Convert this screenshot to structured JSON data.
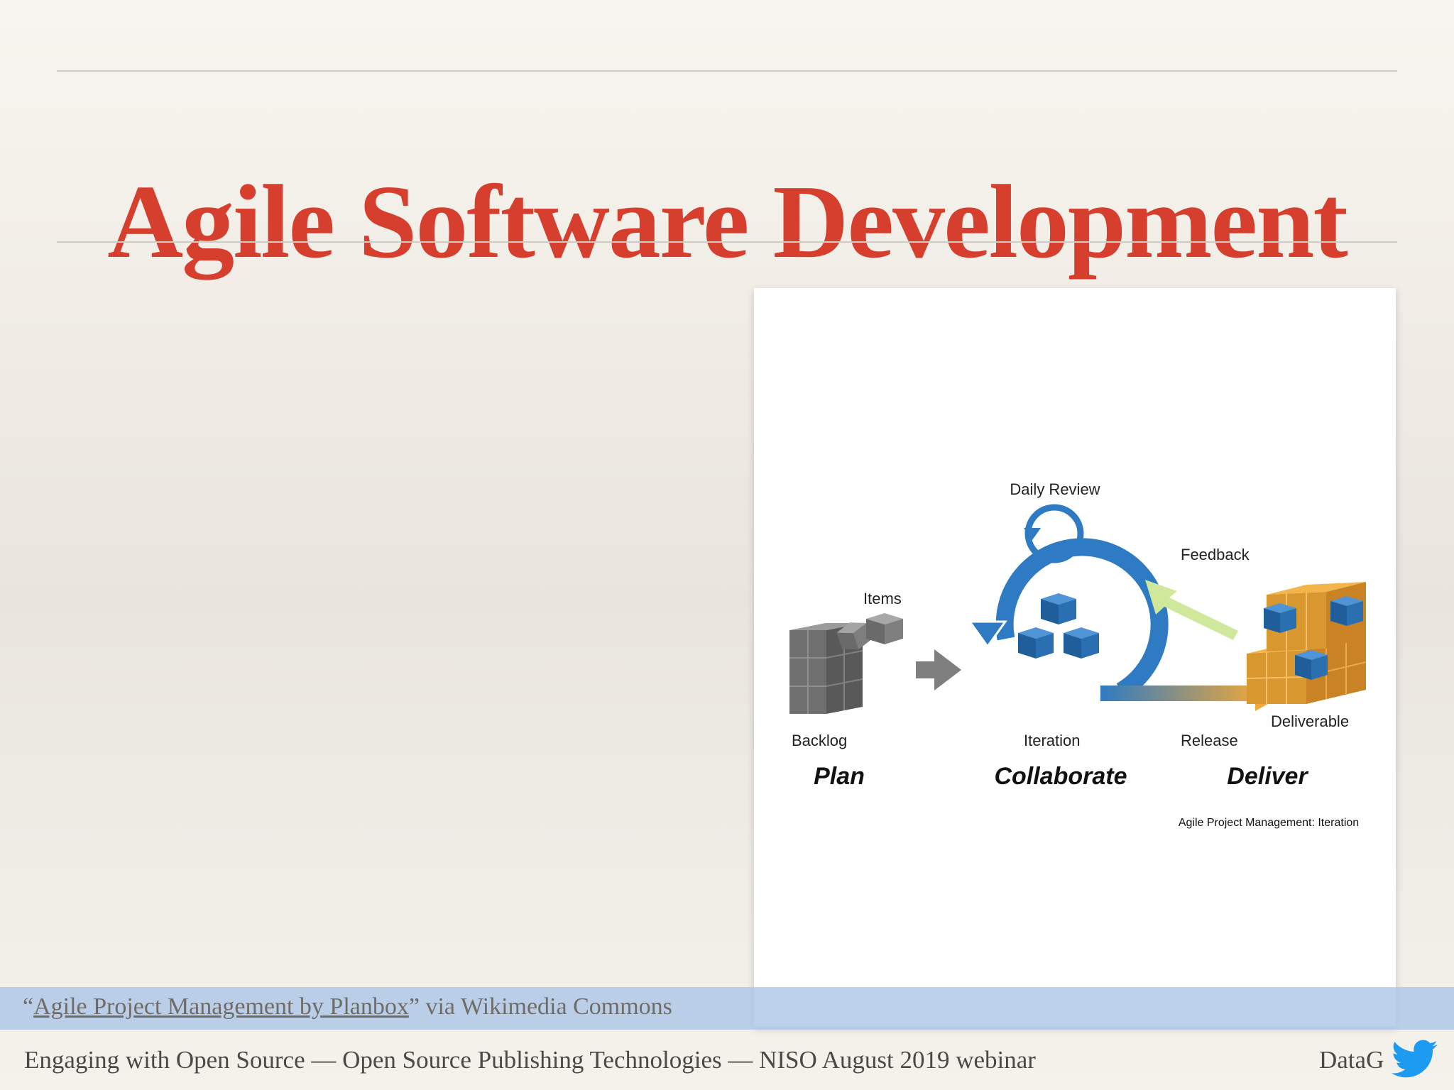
{
  "slide": {
    "title": "Agile Software Development",
    "caption_open_quote": "“",
    "caption_link_text": "Agile Project Management by Planbox",
    "caption_suffix": "” via Wikimedia Commons",
    "footer_text": "Engaging with Open Source — Open Source Publishing Technologies — NISO August 2019 webinar",
    "author": "DataG",
    "twitter_icon": "twitter-bird-icon"
  },
  "figure": {
    "labels": {
      "daily_review": "Daily Review",
      "feedback": "Feedback",
      "items": "Items",
      "deliverable": "Deliverable",
      "backlog": "Backlog",
      "iteration": "Iteration",
      "release": "Release"
    },
    "phases": {
      "plan": "Plan",
      "collaborate": "Collaborate",
      "deliver": "Deliver"
    },
    "caption": "Agile Project Management: Iteration",
    "colors": {
      "blue": "#2f7bc3",
      "cube_blue": "#2a6faf",
      "grey": "#7b7b7b",
      "orange": "#f0a83a",
      "feedback_green": "#cfe89c",
      "title_red": "#d63e2e"
    }
  }
}
